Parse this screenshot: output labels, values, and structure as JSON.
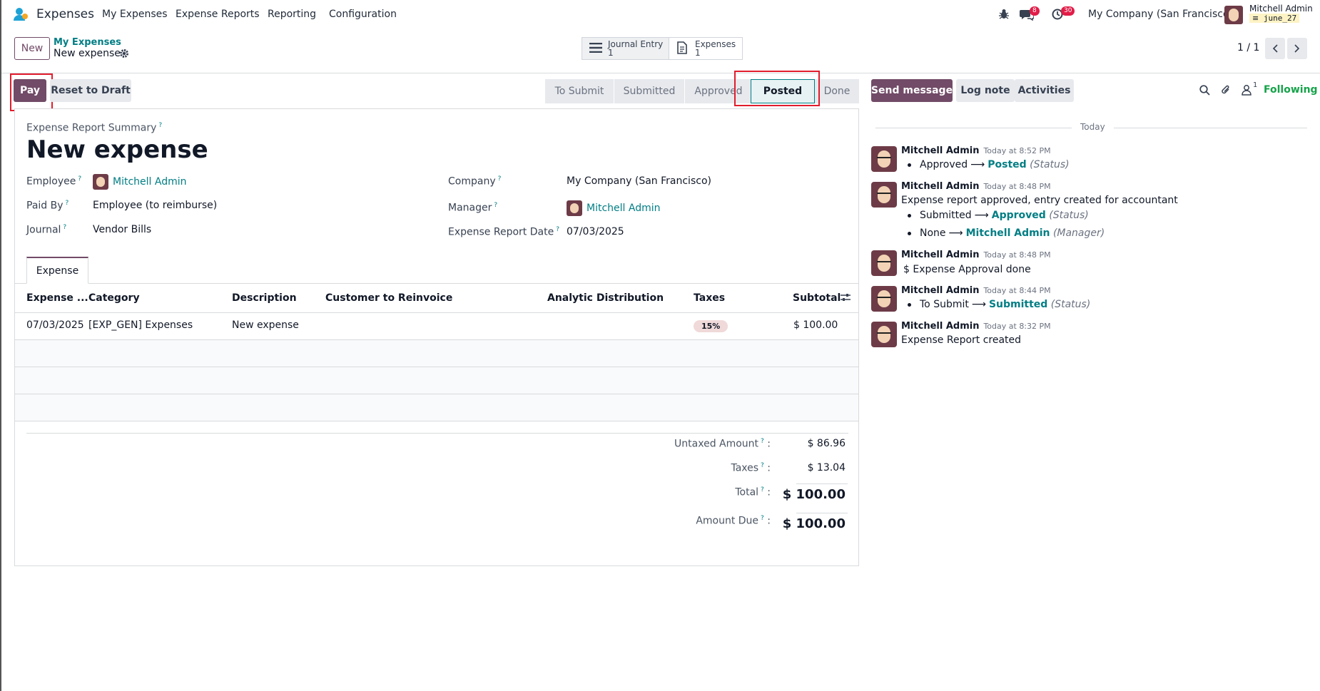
{
  "nav": {
    "app_name": "Expenses",
    "menu": [
      "My Expenses",
      "Expense Reports",
      "Reporting",
      "Configuration"
    ],
    "messages_count": "8",
    "activities_count": "30",
    "company": "My Company (San Francisco)",
    "user_name": "Mitchell Admin",
    "db_name": "june_27"
  },
  "control": {
    "new_label": "New",
    "breadcrumb_parent": "My Expenses",
    "breadcrumb_current": "New expense",
    "smart_buttons": [
      {
        "label": "Journal Entry",
        "count": "1"
      },
      {
        "label": "Expenses",
        "count": "1"
      }
    ],
    "pager": "1 / 1"
  },
  "actions": {
    "pay": "Pay",
    "reset": "Reset to Draft"
  },
  "stages": [
    "To Submit",
    "Submitted",
    "Approved",
    "Posted",
    "Done"
  ],
  "active_stage": "Posted",
  "form": {
    "summary_label": "Expense Report Summary",
    "title": "New expense",
    "employee_label": "Employee",
    "employee": "Mitchell Admin",
    "paid_by_label": "Paid By",
    "paid_by": "Employee (to reimburse)",
    "journal_label": "Journal",
    "journal": "Vendor Bills",
    "company_label": "Company",
    "company": "My Company (San Francisco)",
    "manager_label": "Manager",
    "manager": "Mitchell Admin",
    "date_label": "Expense Report Date",
    "date": "07/03/2025",
    "tab": "Expense"
  },
  "table": {
    "headers": [
      "Expense ...",
      "Category",
      "Description",
      "Customer to Reinvoice",
      "Analytic Distribution",
      "Taxes",
      "Subtotal"
    ],
    "rows": [
      {
        "date": "07/03/2025",
        "category": "[EXP_GEN] Expenses",
        "description": "New expense",
        "customer": "",
        "analytic": "",
        "taxes": "15%",
        "subtotal": "$ 100.00"
      }
    ]
  },
  "totals": {
    "untaxed_label": "Untaxed Amount",
    "untaxed": "$ 86.96",
    "taxes_label": "Taxes",
    "taxes": "$ 13.04",
    "total_label": "Total",
    "total": "$ 100.00",
    "due_label": "Amount Due",
    "due": "$ 100.00"
  },
  "chatter": {
    "send_message": "Send message",
    "log_note": "Log note",
    "activities": "Activities",
    "followers_count": "1",
    "following": "Following",
    "date_separator": "Today",
    "messages": [
      {
        "author": "Mitchell Admin",
        "time": "Today at 8:52 PM",
        "body": "",
        "changes": [
          {
            "from": "Approved",
            "to": "Posted",
            "field": "(Status)"
          }
        ]
      },
      {
        "author": "Mitchell Admin",
        "time": "Today at 8:48 PM",
        "body": "Expense report approved, entry created for accountant",
        "changes": [
          {
            "from": "Submitted",
            "to": "Approved",
            "field": "(Status)"
          },
          {
            "from": "None",
            "to": "Mitchell Admin",
            "field": "(Manager)"
          }
        ]
      },
      {
        "author": "Mitchell Admin",
        "time": "Today at 8:48 PM",
        "body": "$ Expense Approval done",
        "changes": []
      },
      {
        "author": "Mitchell Admin",
        "time": "Today at 8:44 PM",
        "body": "",
        "changes": [
          {
            "from": "To Submit",
            "to": "Submitted",
            "field": "(Status)"
          }
        ]
      },
      {
        "author": "Mitchell Admin",
        "time": "Today at 8:32 PM",
        "body": "Expense Report created",
        "changes": []
      }
    ]
  }
}
